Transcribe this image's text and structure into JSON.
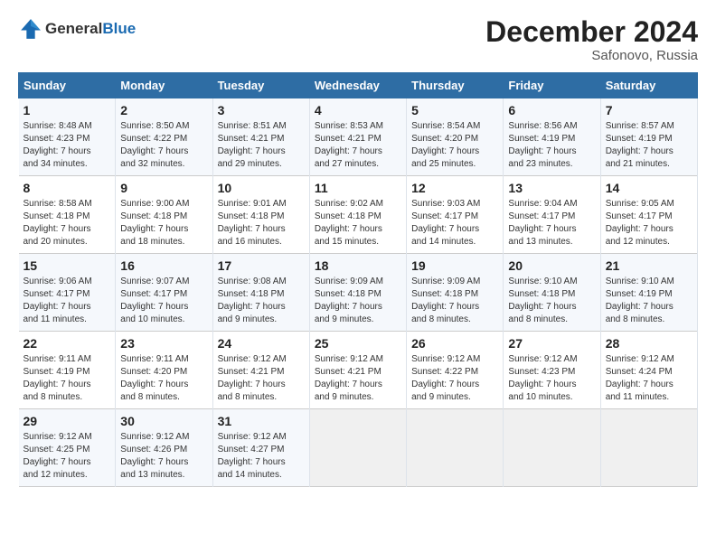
{
  "header": {
    "logo_general": "General",
    "logo_blue": "Blue",
    "title": "December 2024",
    "location": "Safonovo, Russia"
  },
  "days_of_week": [
    "Sunday",
    "Monday",
    "Tuesday",
    "Wednesday",
    "Thursday",
    "Friday",
    "Saturday"
  ],
  "weeks": [
    [
      {
        "day": "1",
        "info": "Sunrise: 8:48 AM\nSunset: 4:23 PM\nDaylight: 7 hours\nand 34 minutes."
      },
      {
        "day": "2",
        "info": "Sunrise: 8:50 AM\nSunset: 4:22 PM\nDaylight: 7 hours\nand 32 minutes."
      },
      {
        "day": "3",
        "info": "Sunrise: 8:51 AM\nSunset: 4:21 PM\nDaylight: 7 hours\nand 29 minutes."
      },
      {
        "day": "4",
        "info": "Sunrise: 8:53 AM\nSunset: 4:21 PM\nDaylight: 7 hours\nand 27 minutes."
      },
      {
        "day": "5",
        "info": "Sunrise: 8:54 AM\nSunset: 4:20 PM\nDaylight: 7 hours\nand 25 minutes."
      },
      {
        "day": "6",
        "info": "Sunrise: 8:56 AM\nSunset: 4:19 PM\nDaylight: 7 hours\nand 23 minutes."
      },
      {
        "day": "7",
        "info": "Sunrise: 8:57 AM\nSunset: 4:19 PM\nDaylight: 7 hours\nand 21 minutes."
      }
    ],
    [
      {
        "day": "8",
        "info": "Sunrise: 8:58 AM\nSunset: 4:18 PM\nDaylight: 7 hours\nand 20 minutes."
      },
      {
        "day": "9",
        "info": "Sunrise: 9:00 AM\nSunset: 4:18 PM\nDaylight: 7 hours\nand 18 minutes."
      },
      {
        "day": "10",
        "info": "Sunrise: 9:01 AM\nSunset: 4:18 PM\nDaylight: 7 hours\nand 16 minutes."
      },
      {
        "day": "11",
        "info": "Sunrise: 9:02 AM\nSunset: 4:18 PM\nDaylight: 7 hours\nand 15 minutes."
      },
      {
        "day": "12",
        "info": "Sunrise: 9:03 AM\nSunset: 4:17 PM\nDaylight: 7 hours\nand 14 minutes."
      },
      {
        "day": "13",
        "info": "Sunrise: 9:04 AM\nSunset: 4:17 PM\nDaylight: 7 hours\nand 13 minutes."
      },
      {
        "day": "14",
        "info": "Sunrise: 9:05 AM\nSunset: 4:17 PM\nDaylight: 7 hours\nand 12 minutes."
      }
    ],
    [
      {
        "day": "15",
        "info": "Sunrise: 9:06 AM\nSunset: 4:17 PM\nDaylight: 7 hours\nand 11 minutes."
      },
      {
        "day": "16",
        "info": "Sunrise: 9:07 AM\nSunset: 4:17 PM\nDaylight: 7 hours\nand 10 minutes."
      },
      {
        "day": "17",
        "info": "Sunrise: 9:08 AM\nSunset: 4:18 PM\nDaylight: 7 hours\nand 9 minutes."
      },
      {
        "day": "18",
        "info": "Sunrise: 9:09 AM\nSunset: 4:18 PM\nDaylight: 7 hours\nand 9 minutes."
      },
      {
        "day": "19",
        "info": "Sunrise: 9:09 AM\nSunset: 4:18 PM\nDaylight: 7 hours\nand 8 minutes."
      },
      {
        "day": "20",
        "info": "Sunrise: 9:10 AM\nSunset: 4:18 PM\nDaylight: 7 hours\nand 8 minutes."
      },
      {
        "day": "21",
        "info": "Sunrise: 9:10 AM\nSunset: 4:19 PM\nDaylight: 7 hours\nand 8 minutes."
      }
    ],
    [
      {
        "day": "22",
        "info": "Sunrise: 9:11 AM\nSunset: 4:19 PM\nDaylight: 7 hours\nand 8 minutes."
      },
      {
        "day": "23",
        "info": "Sunrise: 9:11 AM\nSunset: 4:20 PM\nDaylight: 7 hours\nand 8 minutes."
      },
      {
        "day": "24",
        "info": "Sunrise: 9:12 AM\nSunset: 4:21 PM\nDaylight: 7 hours\nand 8 minutes."
      },
      {
        "day": "25",
        "info": "Sunrise: 9:12 AM\nSunset: 4:21 PM\nDaylight: 7 hours\nand 9 minutes."
      },
      {
        "day": "26",
        "info": "Sunrise: 9:12 AM\nSunset: 4:22 PM\nDaylight: 7 hours\nand 9 minutes."
      },
      {
        "day": "27",
        "info": "Sunrise: 9:12 AM\nSunset: 4:23 PM\nDaylight: 7 hours\nand 10 minutes."
      },
      {
        "day": "28",
        "info": "Sunrise: 9:12 AM\nSunset: 4:24 PM\nDaylight: 7 hours\nand 11 minutes."
      }
    ],
    [
      {
        "day": "29",
        "info": "Sunrise: 9:12 AM\nSunset: 4:25 PM\nDaylight: 7 hours\nand 12 minutes."
      },
      {
        "day": "30",
        "info": "Sunrise: 9:12 AM\nSunset: 4:26 PM\nDaylight: 7 hours\nand 13 minutes."
      },
      {
        "day": "31",
        "info": "Sunrise: 9:12 AM\nSunset: 4:27 PM\nDaylight: 7 hours\nand 14 minutes."
      },
      null,
      null,
      null,
      null
    ]
  ]
}
